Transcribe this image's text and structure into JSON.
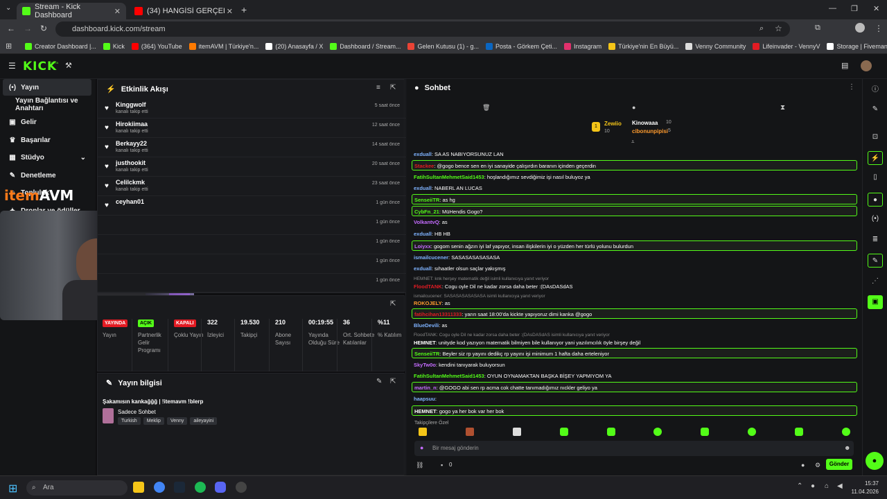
{
  "browser": {
    "tabs": [
      {
        "title": "Stream - Kick Dashboard",
        "active": true
      },
      {
        "title": "(34) HANGİSİ GERÇEK ESKİ SEV",
        "active": false
      }
    ],
    "url": "dashboard.kick.com/stream",
    "bookmarks": [
      "Creator Dashboard |...",
      "Kick",
      "(364) YouTube",
      "itemAVM | Türkiye'n...",
      "(20) Anasayfa / X",
      "Dashboard / Stream...",
      "Gelen Kutusu (1) - g...",
      "Posta - Görkem Çeti...",
      "Instagram",
      "Türkiye'nin En Büyü...",
      "Venny Community",
      "Lifeinvader - VennyV",
      "Storage | Fivemanage"
    ]
  },
  "kick": {
    "logo": "KICK",
    "beta": "BETA"
  },
  "nav": {
    "items": [
      "Yayın",
      "Yayın Bağlantısı ve Anahtarı",
      "Gelir",
      "Başarılar",
      "Stüdyo",
      "Denetleme",
      "Topluluk",
      "Droplar ve ödüller"
    ]
  },
  "activity": {
    "title": "Etkinlik Akışı",
    "items": [
      {
        "name": "Kinggwolf",
        "sub": "kanalı takip etti",
        "time": "5 saat önce"
      },
      {
        "name": "Hirokiimaa",
        "sub": "kanalı takip etti",
        "time": "12 saat önce"
      },
      {
        "name": "Berkayy22",
        "sub": "kanalı takip etti",
        "time": "14 saat önce"
      },
      {
        "name": "justhookit",
        "sub": "kanalı takip etti",
        "time": "20 saat önce"
      },
      {
        "name": "Celilckmk",
        "sub": "kanalı takip etti",
        "time": "23 saat önce"
      },
      {
        "name": "ceyhan01",
        "sub": "",
        "time": "1 gün önce"
      },
      {
        "name": "",
        "sub": "",
        "time": "1 gün önce"
      },
      {
        "name": "",
        "sub": "",
        "time": "1 gün önce"
      },
      {
        "name": "",
        "sub": "",
        "time": "1 gün önce"
      },
      {
        "name": "",
        "sub": "",
        "time": "1 gün önce"
      }
    ]
  },
  "stats": [
    {
      "badge": "YAYINDA",
      "badgeColor": "#e31b23",
      "label": "Yayın"
    },
    {
      "badge": "AÇIK",
      "badgeColor": "#53fc18",
      "label": "Partnerlik Gelir Programı"
    },
    {
      "badge": "KAPALI",
      "badgeColor": "#e31b23",
      "label": "Çoklu Yayın"
    },
    {
      "value": "322",
      "label": "İzleyici"
    },
    {
      "value": "19.530",
      "label": "Takipçi"
    },
    {
      "value": "210",
      "label": "Abone Sayısı"
    },
    {
      "value": "00:19:55",
      "label": "Yayında Olduğu Süre"
    },
    {
      "value": "36",
      "label": "Ort. Sohbete Katılanlar"
    },
    {
      "value": "%11",
      "label": "% Katılım"
    }
  ],
  "info": {
    "title": "Yayın bilgisi",
    "stream_title": "Şakamısın kankağğğ | !itemavm !blerp",
    "category": "Sadece Sohbet",
    "tags": [
      "Turkish",
      "Meklip",
      "Venny",
      "aileyayini"
    ]
  },
  "chat": {
    "title": "Sohbet",
    "leaders": {
      "first": {
        "name": "Zewiio",
        "count": "10"
      },
      "second": {
        "name": "Kinowaaa",
        "count": "10"
      },
      "third": {
        "name": "cibonunpipisi",
        "count": "5"
      }
    },
    "messages": [
      {
        "user": "exduall",
        "color": "#7fb3ff",
        "text": "SA AS NABIYORSUNUZ LAN",
        "hl": false
      },
      {
        "user": "Stackee",
        "color": "#e31b23",
        "text": "@gogo bence sen en iyi sanayide çalışırdın baranın içinden geçerdin",
        "hl": true
      },
      {
        "user": "FatihSultanMehmetSaid1453",
        "color": "#53fc18",
        "text": "hoşlandığımız sevdiğimiz işi nasıl buluyoz ya",
        "hl": false
      },
      {
        "user": "exduall",
        "color": "#7fb3ff",
        "text": "NABERL AN LUCAS",
        "hl": false
      },
      {
        "user": "SenseiiTR",
        "color": "#53fc18",
        "text": "as hg",
        "hl": true
      },
      {
        "user": "CybFn_21",
        "color": "#53fc18",
        "text": "MüHendis Gogo?",
        "hl": true
      },
      {
        "user": "VolkantvQ",
        "color": "#c56cff",
        "text": "as",
        "hl": false
      },
      {
        "user": "exduall",
        "color": "#7fb3ff",
        "text": "HB HB",
        "hl": false
      },
      {
        "user": "Loiyxx",
        "color": "#c56cff",
        "text": "gogom senin ağzın iyi laf yapıyor, insan ilişkilerin iyi o yüzden her türlü yolunu bulurdun",
        "hl": true
      },
      {
        "user": "ismailcucener",
        "color": "#7fb3ff",
        "text": "SASASASASASASA",
        "hl": false
      },
      {
        "user": "exduall",
        "color": "#7fb3ff",
        "text": "sıhaatler olsun saçlar yakışmış",
        "hl": false
      },
      {
        "reply": "HEMNET: knk herşey matematik değil isimli kullanıcıya yanıt veriyor"
      },
      {
        "user": "FloodTANK",
        "color": "#e31b23",
        "text": "Cogu oyle Dil ne kadar zorsa daha beter :(DAsDASdAS",
        "hl": false
      },
      {
        "reply": "ismailcucener: SASASASASASASA isimli kullanıcıya yanıt veriyor"
      },
      {
        "user": "ROKOJELY",
        "color": "#ff9b2e",
        "text": "as",
        "hl": false
      },
      {
        "user": "fatihcihan13311333",
        "color": "#e31b23",
        "text": "yarın saat 18:00'da kickte yapıyoruz dimi kanka @gogo",
        "hl": true
      },
      {
        "user": "BlueDevili",
        "color": "#7fb3ff",
        "text": "as",
        "hl": false
      },
      {
        "reply": "FloodTANK: Cogu oyle Dil ne kadar zorsa daha beter :(DAsDASdAS isimli kullanıcıya yanıt veriyor"
      },
      {
        "user": "HEMNET",
        "color": "#ffffff",
        "text": "unityde kod yazıyon matematik bilmiyen bile kullanıyor yani yazılımcılık öyle birşey değil",
        "hl": false
      },
      {
        "user": "SenseiiTR",
        "color": "#53fc18",
        "text": "Beyler siz rp yayını dedikç rp yayını işi minimum 1 hafta daha erteleniyor",
        "hl": true
      },
      {
        "user": "SkyTw0o",
        "color": "#c56cff",
        "text": "kendini tanıyarak buluyorsun",
        "hl": false
      },
      {
        "user": "FatihSultanMehmetSaid1453",
        "color": "#53fc18",
        "text": "OYUN OYNAMAKTAN BAŞKA BİŞEY YAPMIYOM YA",
        "hl": false
      },
      {
        "user": "martin_n",
        "color": "#c56cff",
        "text": "@GOGO abi sen rp acma cok chatte tanımadığımız nıckler geliyo ya",
        "hl": true
      },
      {
        "user": "haapsuu",
        "color": "#7fb3ff",
        "text": "",
        "hl": false
      },
      {
        "user": "HEMNET",
        "color": "#ffffff",
        "text": "gogo ya her bok var her bok",
        "hl": true
      }
    ],
    "follower_only": "Takipçilere Özel",
    "placeholder": "Bir mesaj gönderin",
    "send": "Gönder",
    "counter": "0"
  },
  "taskbar": {
    "search": "Ara",
    "time": "15:37",
    "date": "11.04.2026"
  }
}
